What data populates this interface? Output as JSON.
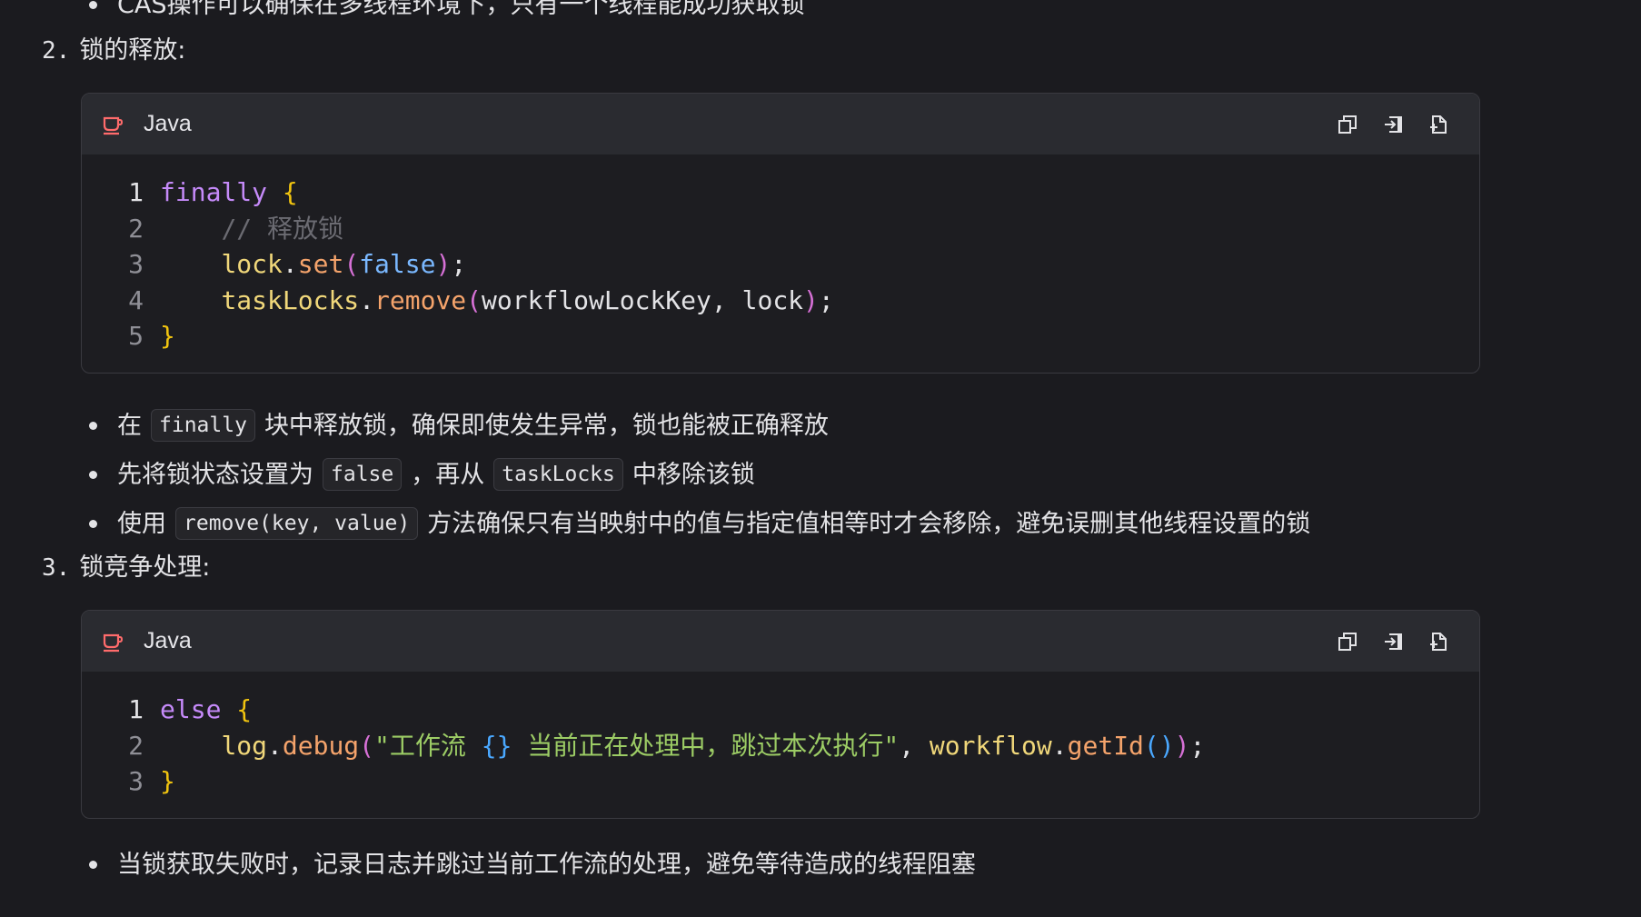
{
  "top_bullet": {
    "text": "CAS操作可以确保在多线程环境下，只有一个线程能成功获取锁"
  },
  "section2": {
    "number": "2.",
    "title": "锁的释放:"
  },
  "code_block_1": {
    "language": "Java",
    "lines": [
      {
        "num": "1",
        "tokens": [
          [
            "kw",
            "finally"
          ],
          [
            "plain",
            " "
          ],
          [
            "brace-y",
            "{"
          ]
        ]
      },
      {
        "num": "2",
        "tokens": [
          [
            "plain",
            "    "
          ],
          [
            "cm",
            "// 释放锁"
          ]
        ]
      },
      {
        "num": "3",
        "tokens": [
          [
            "plain",
            "    "
          ],
          [
            "id",
            "lock"
          ],
          [
            "plain",
            "."
          ],
          [
            "fn",
            "set"
          ],
          [
            "brace-p",
            "("
          ],
          [
            "lit",
            "false"
          ],
          [
            "brace-p",
            ")"
          ],
          [
            "plain",
            ";"
          ]
        ]
      },
      {
        "num": "4",
        "tokens": [
          [
            "plain",
            "    "
          ],
          [
            "id",
            "taskLocks"
          ],
          [
            "plain",
            "."
          ],
          [
            "fn",
            "remove"
          ],
          [
            "brace-p",
            "("
          ],
          [
            "plain",
            "workflowLockKey, lock"
          ],
          [
            "brace-p",
            ")"
          ],
          [
            "plain",
            ";"
          ]
        ]
      },
      {
        "num": "5",
        "tokens": [
          [
            "brace-y",
            "}"
          ]
        ]
      }
    ]
  },
  "bullets_2": [
    {
      "before": "在",
      "code": "finally",
      "after": "块中释放锁，确保即使发生异常，锁也能被正确释放"
    },
    {
      "before": "先将锁状态设置为",
      "code": "false",
      "middle": "，再从",
      "code2": "taskLocks",
      "after": "中移除该锁"
    },
    {
      "before": "使用",
      "code": "remove(key, value)",
      "after": "方法确保只有当映射中的值与指定值相等时才会移除，避免误删其他线程设置的锁"
    }
  ],
  "section3": {
    "number": "3.",
    "title": "锁竞争处理:"
  },
  "code_block_2": {
    "language": "Java",
    "lines": [
      {
        "num": "1",
        "tokens": [
          [
            "kw",
            "else"
          ],
          [
            "plain",
            " "
          ],
          [
            "brace-y",
            "{"
          ]
        ]
      },
      {
        "num": "2",
        "tokens": [
          [
            "plain",
            "    "
          ],
          [
            "id",
            "log"
          ],
          [
            "plain",
            "."
          ],
          [
            "fn",
            "debug"
          ],
          [
            "brace-p",
            "("
          ],
          [
            "str",
            "\"工作流 "
          ],
          [
            "brace-b",
            "{}"
          ],
          [
            "str",
            " 当前正在处理中，跳过本次执行\""
          ],
          [
            "plain",
            ", "
          ],
          [
            "id",
            "workflow"
          ],
          [
            "plain",
            "."
          ],
          [
            "fn",
            "getId"
          ],
          [
            "brace-b",
            "()"
          ],
          [
            "brace-p",
            ")"
          ],
          [
            "plain",
            ";"
          ]
        ]
      },
      {
        "num": "3",
        "tokens": [
          [
            "brace-y",
            "}"
          ]
        ]
      }
    ]
  },
  "bullets_3": [
    {
      "text": "当锁获取失败时，记录日志并跳过当前工作流的处理，避免等待造成的线程阻塞"
    }
  ],
  "icons": {
    "language": "coffee-cup-icon",
    "copy": "copy-icon",
    "insert": "insert-into-editor-icon",
    "new_file": "new-file-icon"
  },
  "colors": {
    "background": "#1b1b1f",
    "code_header": "#2a2b30",
    "keyword": "#c58af9",
    "brace": "#f1c40f",
    "string": "#9ccc65",
    "function": "#f4a36b",
    "identifier": "#f0d77a",
    "icon_accent": "#ff6b6b"
  }
}
